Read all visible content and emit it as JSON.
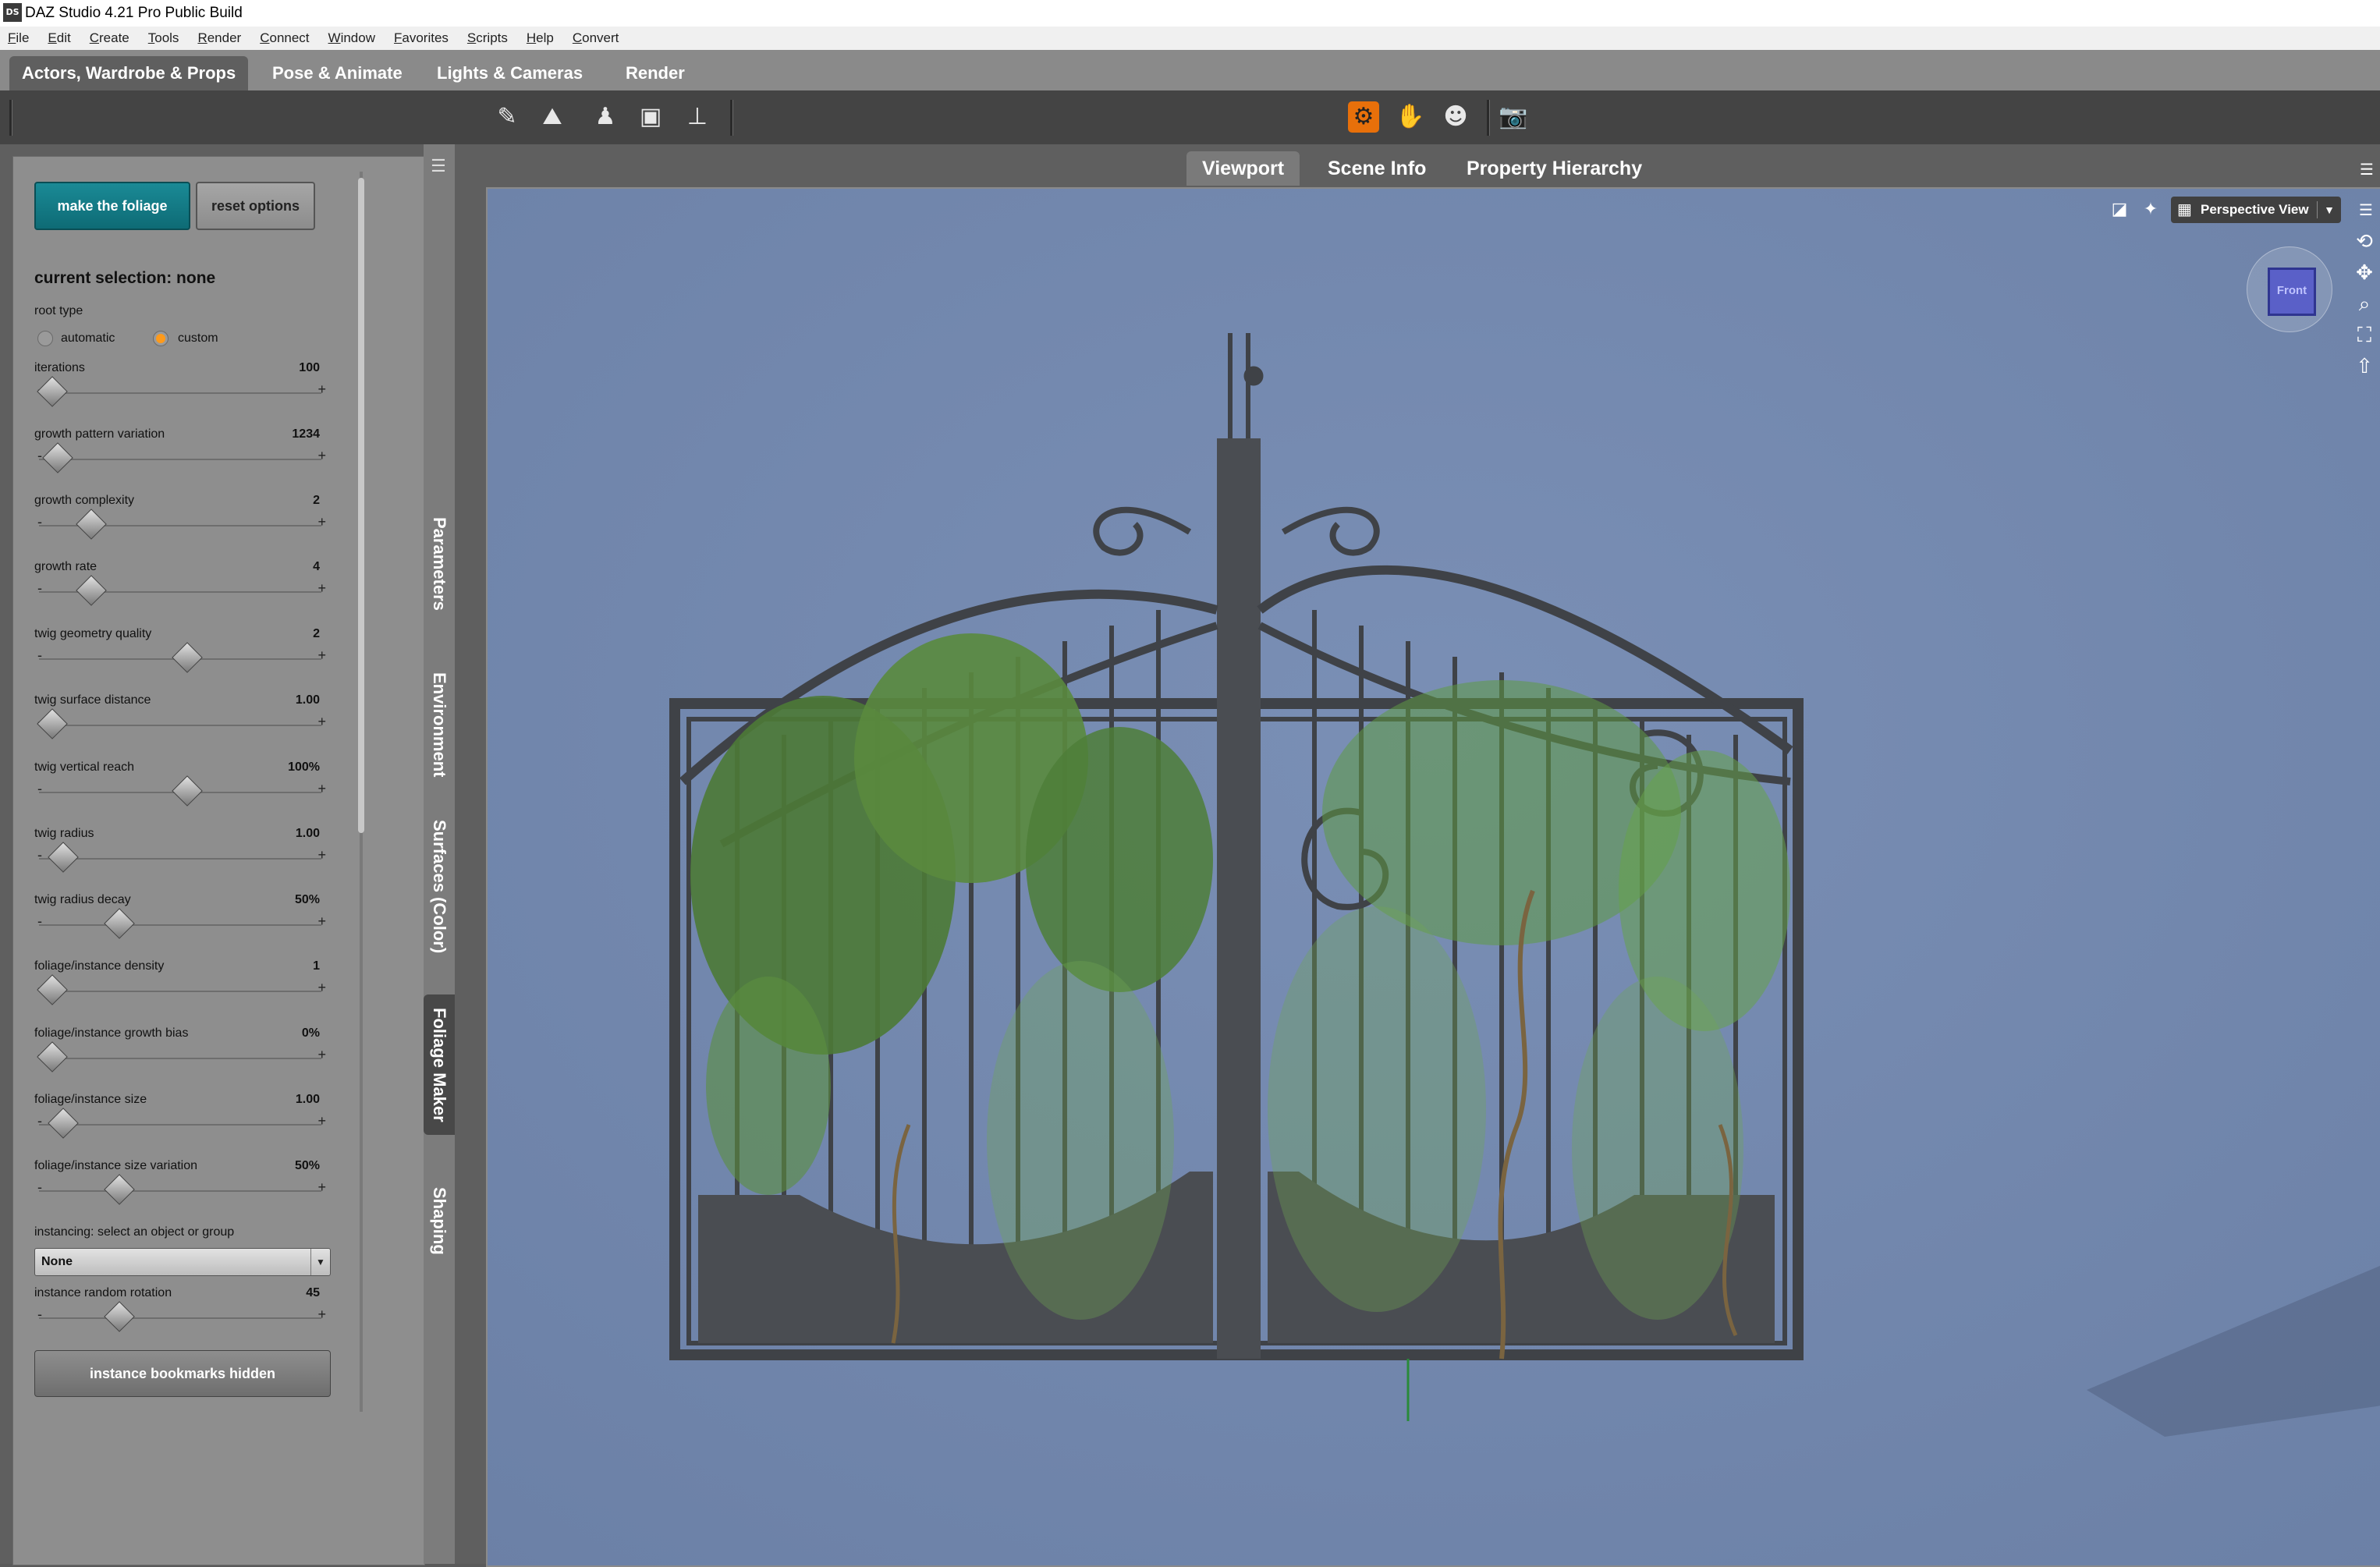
{
  "window": {
    "title": "DAZ Studio 4.21 Pro Public Build",
    "app_icon": "DS"
  },
  "menu": [
    "File",
    "Edit",
    "Create",
    "Tools",
    "Render",
    "Connect",
    "Window",
    "Favorites",
    "Scripts",
    "Help",
    "Convert"
  ],
  "top_tabs": [
    "Actors, Wardrobe & Props",
    "Pose & Animate",
    "Lights & Cameras",
    "Render"
  ],
  "toolbar_icons": [
    "node-selection-icon",
    "scene-ground-icon",
    "figure-pose-icon",
    "spot-render-icon",
    "joint-editor-icon",
    "universal-tool-icon",
    "active-pose-icon",
    "figure-tool-icon",
    "camera-tool-icon"
  ],
  "panel": {
    "make_button": "make the foliage",
    "reset_button": "reset options",
    "selection": "current selection: none",
    "root_type_label": "root type",
    "root_options": [
      "automatic",
      "custom"
    ],
    "root_selected": "custom",
    "sliders": [
      {
        "name": "iterations",
        "value": "100",
        "pos": 0.0
      },
      {
        "name": "growth pattern variation",
        "value": "1234",
        "pos": 0.02
      },
      {
        "name": "growth complexity",
        "value": "2",
        "pos": 0.14
      },
      {
        "name": "growth rate",
        "value": "4",
        "pos": 0.14
      },
      {
        "name": "twig geometry quality",
        "value": "2",
        "pos": 0.48
      },
      {
        "name": "twig surface distance",
        "value": "1.00",
        "pos": 0.0
      },
      {
        "name": "twig vertical reach",
        "value": "100%",
        "pos": 0.48
      },
      {
        "name": "twig radius",
        "value": "1.00",
        "pos": 0.04
      },
      {
        "name": "twig radius decay",
        "value": "50%",
        "pos": 0.24
      },
      {
        "name": "foliage/instance density",
        "value": "1",
        "pos": 0.0
      },
      {
        "name": "foliage/instance growth bias",
        "value": "0%",
        "pos": 0.0
      },
      {
        "name": "foliage/instance size",
        "value": "1.00",
        "pos": 0.04
      },
      {
        "name": "foliage/instance size variation",
        "value": "50%",
        "pos": 0.24
      }
    ],
    "instancing_label": "instancing: select an object or group",
    "instancing_value": "None",
    "instance_rotation": {
      "name": "instance random rotation",
      "value": "45",
      "pos": 0.24
    },
    "bookmarks_button": "instance bookmarks hidden"
  },
  "vertical_tabs": [
    "Parameters",
    "Environment",
    "Surfaces (Color)",
    "Foliage Maker",
    "Shaping"
  ],
  "vertical_tab_active": "Foliage Maker",
  "viewport_tabs": [
    "Viewport",
    "Scene Info",
    "Property Hierarchy"
  ],
  "viewport_tab_active": "Viewport",
  "viewport": {
    "view_select": "Perspective View",
    "cube_label": "Front",
    "background_color": "#7388ae"
  }
}
